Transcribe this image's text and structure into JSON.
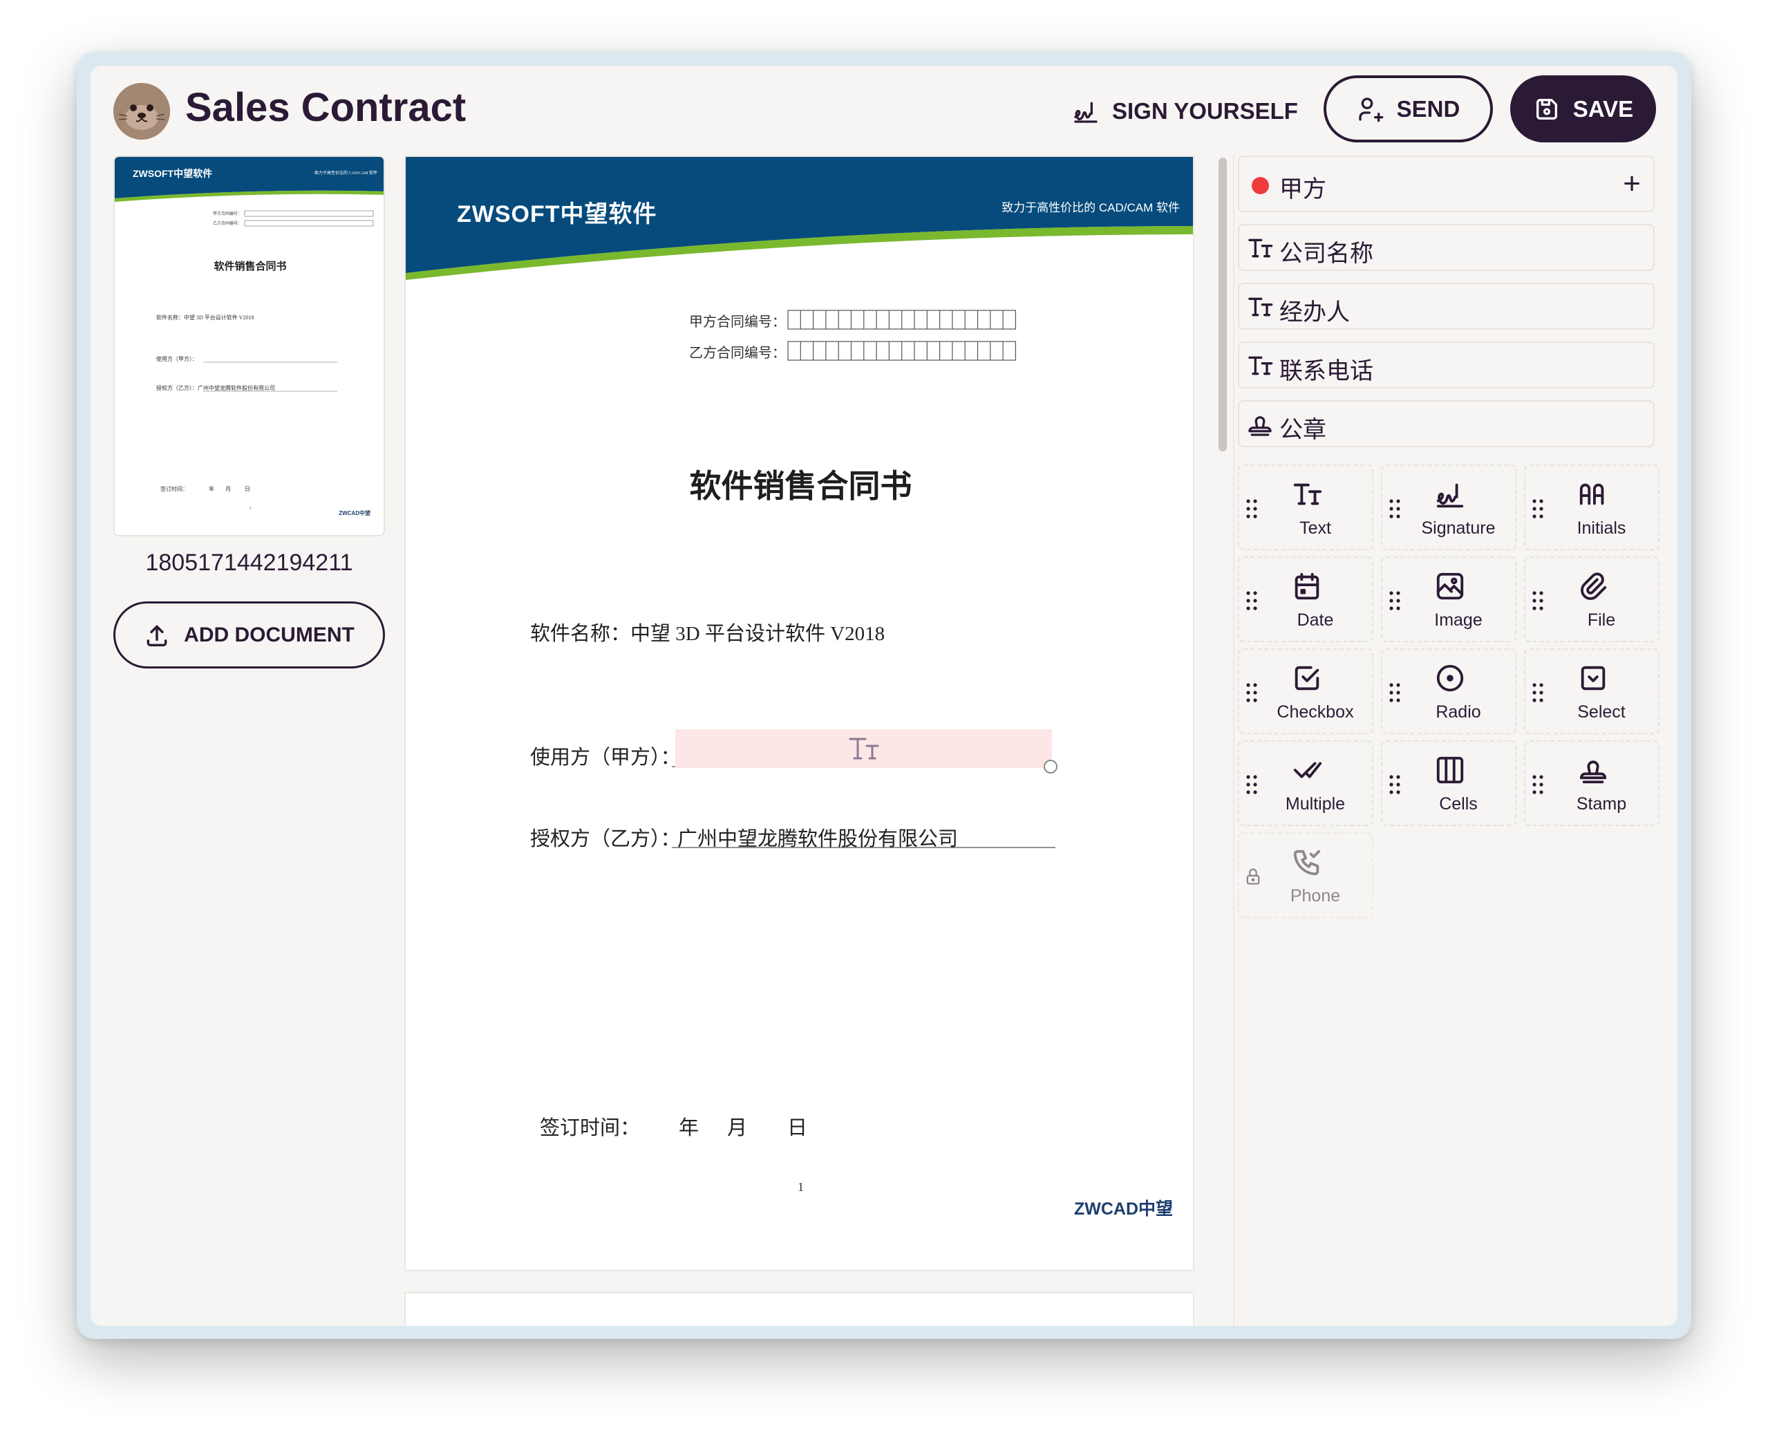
{
  "header": {
    "title": "Sales Contract",
    "sign_yourself_label": "SIGN YOURSELF",
    "send_label": "SEND",
    "save_label": "SAVE"
  },
  "documents": {
    "items": [
      {
        "id": "1805171442194211"
      }
    ],
    "add_label": "ADD DOCUMENT"
  },
  "page": {
    "banner_logo": "ZWSOFT中望软件",
    "banner_tagline": "致力于高性价比的 CAD/CAM 软件",
    "party_a_no_label": "甲方合同编号：",
    "party_b_no_label": "乙方合同编号：",
    "doc_title": "软件销售合同书",
    "software_line": "软件名称：中望 3D 平台设计软件 V2018",
    "user_label": "使用方（甲方）：",
    "licensor_label": "授权方（乙方）：",
    "licensor_value": "广州中望龙腾软件股份有限公司",
    "sign_time_label": "签订时间：",
    "year": "年",
    "month": "月",
    "day": "日",
    "page_number": "1",
    "footer_logo": "ZWCAD中望"
  },
  "thumbnail": {
    "logo": "ZWSOFT中望软件",
    "tagline": "致力于高性价比的 CAD/CAM 软件",
    "a_no": "甲方合同编号：",
    "b_no": "乙方合同编号：",
    "title": "软件销售合同书",
    "software": "软件名称：中望 3D 平台设计软件 V2018",
    "user": "使用方（甲方）：",
    "licensor": "授权方（乙方）：广州中望龙腾软件股份有限公司",
    "sign": "签订时间：",
    "year": "年",
    "month": "月",
    "day": "日",
    "page_number": "1",
    "footer": "ZWCAD中望"
  },
  "party": {
    "name": "甲方",
    "color": "#ef3b3b",
    "fields": [
      {
        "label": "公司名称",
        "icon": "text-icon"
      },
      {
        "label": "经办人",
        "icon": "text-icon"
      },
      {
        "label": "联系电话",
        "icon": "text-icon"
      },
      {
        "label": "公章",
        "icon": "stamp-icon"
      }
    ]
  },
  "field_types": [
    {
      "label": "Text",
      "icon": "text-icon"
    },
    {
      "label": "Signature",
      "icon": "signature-icon"
    },
    {
      "label": "Initials",
      "icon": "initials-icon"
    },
    {
      "label": "Date",
      "icon": "calendar-icon"
    },
    {
      "label": "Image",
      "icon": "image-icon"
    },
    {
      "label": "File",
      "icon": "paperclip-icon"
    },
    {
      "label": "Checkbox",
      "icon": "checkbox-icon"
    },
    {
      "label": "Radio",
      "icon": "radio-icon"
    },
    {
      "label": "Select",
      "icon": "select-icon"
    },
    {
      "label": "Multiple",
      "icon": "double-check-icon"
    },
    {
      "label": "Cells",
      "icon": "cells-icon"
    },
    {
      "label": "Stamp",
      "icon": "stamp-icon"
    },
    {
      "label": "Phone",
      "icon": "phone-icon",
      "locked": true
    }
  ],
  "colors": {
    "primary": "#2b1a35",
    "background": "#f7f5f3",
    "banner_blue": "#064b7c",
    "banner_green": "#7ab82d",
    "field_highlight": "#fde6e6",
    "party_dot": "#ef3b3b"
  }
}
